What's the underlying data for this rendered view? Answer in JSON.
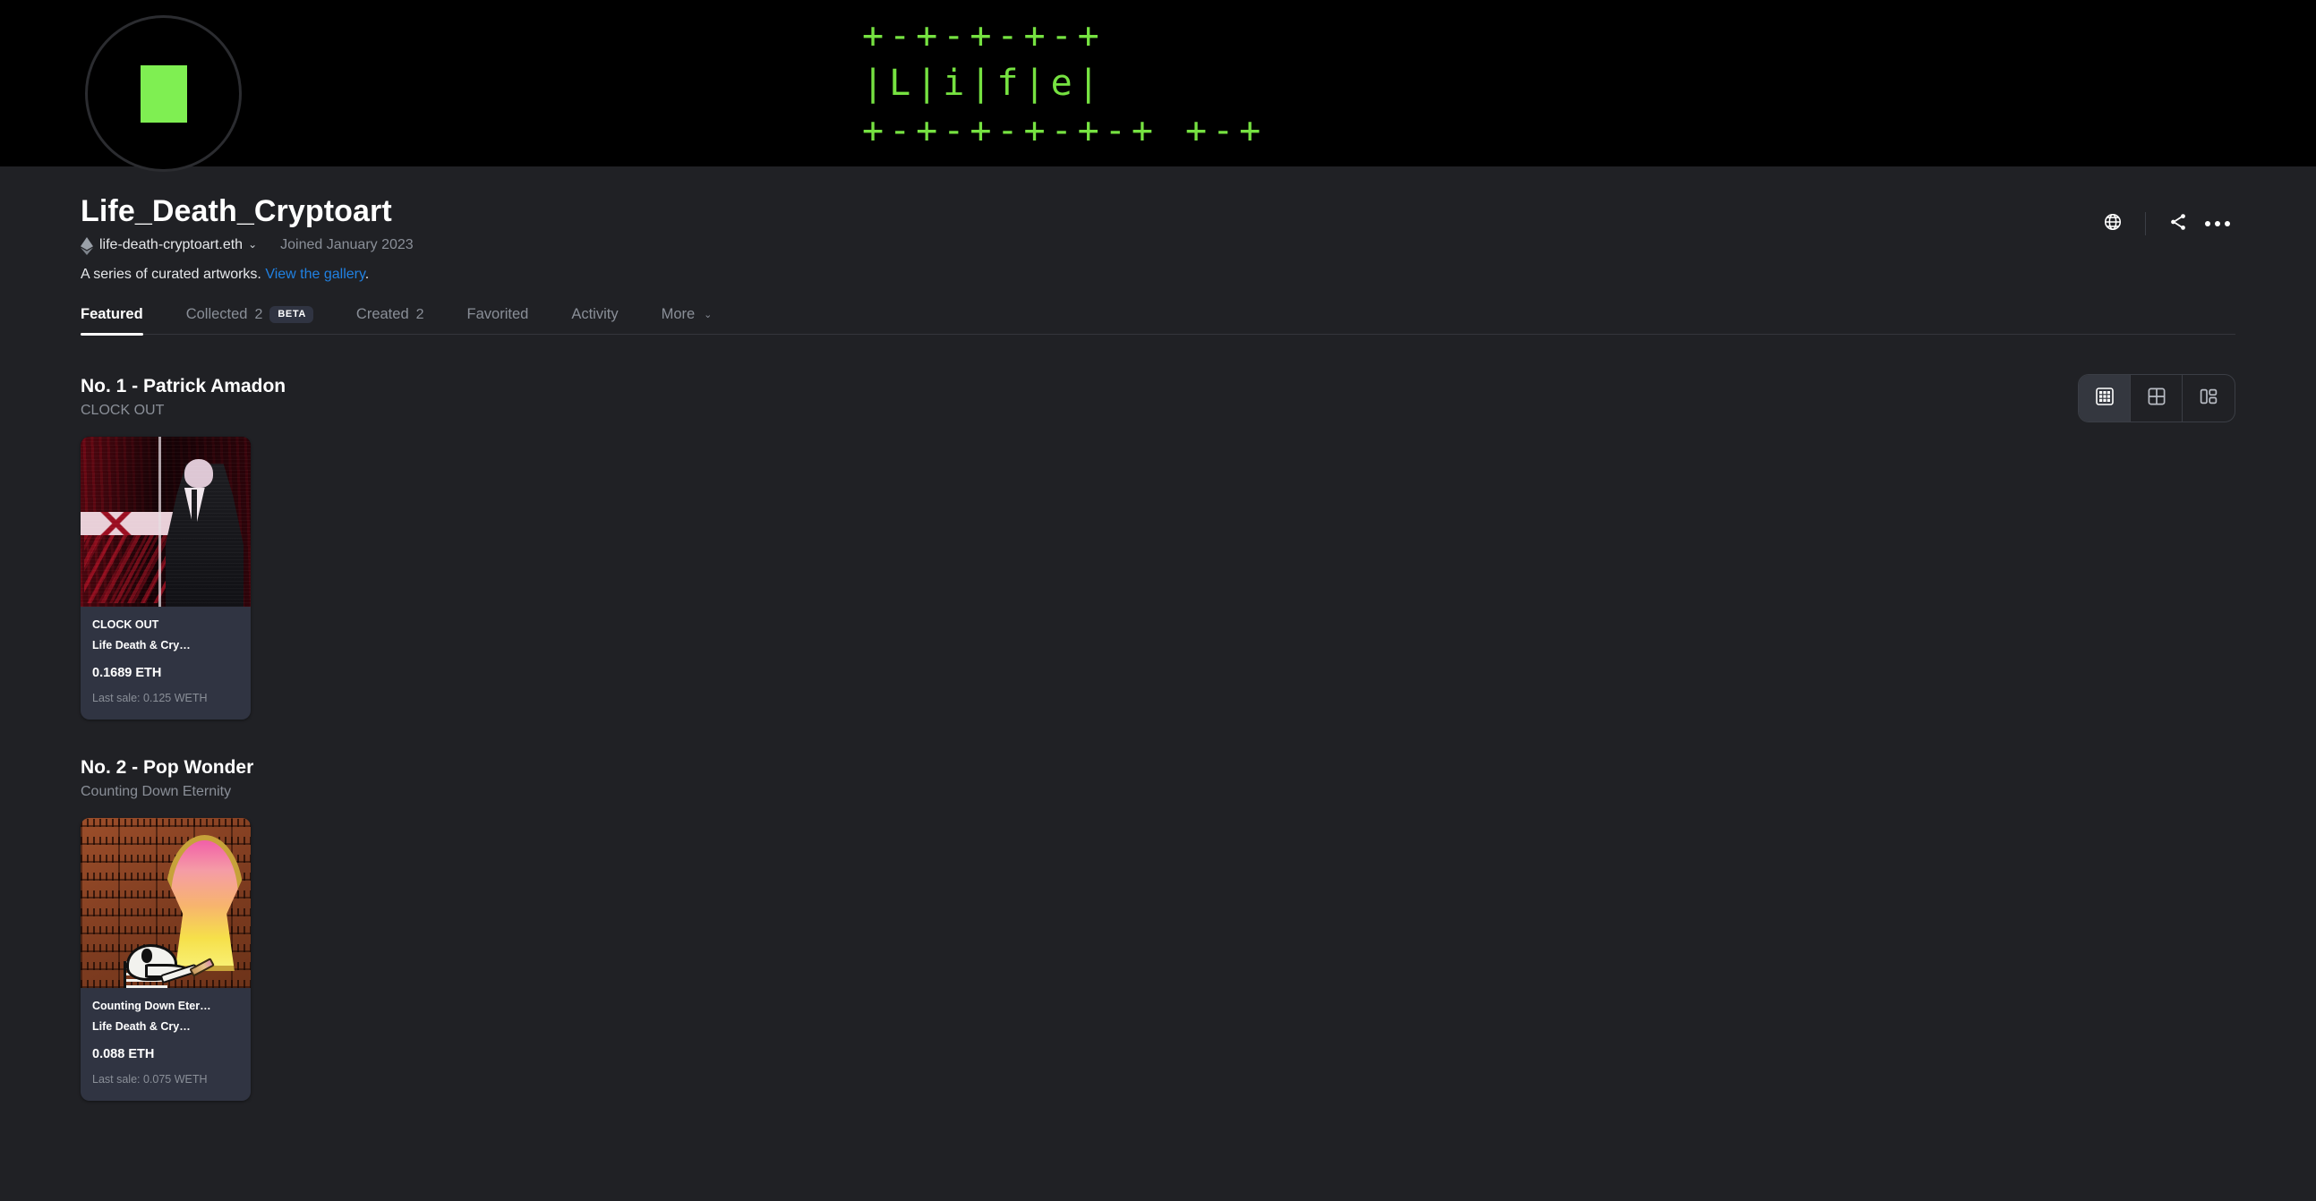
{
  "banner": {
    "ascii_art": "+-+-+-+-+\n|L|i|f|e|\n+-+-+-+-+-+ +-+",
    "accent_color": "#76e241",
    "background_color": "#000000"
  },
  "avatar": {
    "name": "profile-avatar",
    "mark_color": "#7fef52"
  },
  "profile": {
    "title": "Life_Death_Cryptoart",
    "wallet": "life-death-cryptoart.eth",
    "wallet_caret": "⌄",
    "joined": "Joined January 2023",
    "bio_text": "A series of curated artworks.",
    "bio_link": "View the gallery",
    "bio_suffix": ".",
    "link_color": "#2081e2"
  },
  "header_actions": {
    "website_icon": "globe-icon",
    "share_icon": "share-icon",
    "more_icon": "more-dots-icon"
  },
  "tabs": [
    {
      "label": "Featured",
      "count": "",
      "badge": "",
      "active": true
    },
    {
      "label": "Collected",
      "count": "2",
      "badge": "BETA",
      "active": false
    },
    {
      "label": "Created",
      "count": "2",
      "badge": "",
      "active": false
    },
    {
      "label": "Favorited",
      "count": "",
      "badge": "",
      "active": false
    },
    {
      "label": "Activity",
      "count": "",
      "badge": "",
      "active": false
    },
    {
      "label": "More",
      "count": "",
      "badge": "",
      "caret": "⌄",
      "active": false
    }
  ],
  "view_toggle": {
    "options": [
      {
        "name": "grid-small-view",
        "active": true
      },
      {
        "name": "grid-large-view",
        "active": false
      },
      {
        "name": "list-detail-view",
        "active": false
      }
    ]
  },
  "sections": [
    {
      "title": "No. 1 - Patrick Amadon",
      "subtitle": "CLOCK OUT",
      "items": [
        {
          "art": "art1",
          "name": "CLOCK OUT",
          "collection": "Life Death & Cry…",
          "price": "0.1689 ETH",
          "last_sale": "Last sale: 0.125 WETH"
        }
      ]
    },
    {
      "title": "No. 2 - Pop Wonder",
      "subtitle": "Counting Down Eternity",
      "items": [
        {
          "art": "art2",
          "name": "Counting Down Eter…",
          "collection": "Life Death & Cry…",
          "price": "0.088 ETH",
          "last_sale": "Last sale: 0.075 WETH"
        }
      ]
    }
  ],
  "theme": {
    "page_background": "#202125",
    "card_background": "#303442",
    "muted_text": "#8a8f98",
    "primary_text": "#ffffff"
  }
}
